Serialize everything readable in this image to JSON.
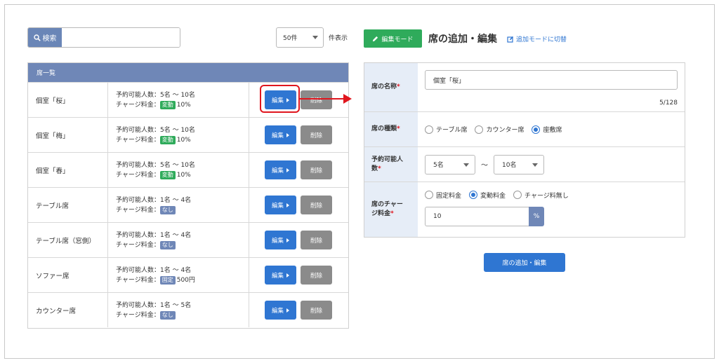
{
  "search": {
    "button_label": "検索",
    "placeholder": ""
  },
  "perpage": {
    "value": "50件",
    "suffix": "件表示"
  },
  "list": {
    "header": "席一覧",
    "edit_label": "編集",
    "delete_label": "削除",
    "rows": [
      {
        "name": "個室「桜」",
        "capacity": "予約可能人数：5名 〜 10名",
        "charge_label": "チャージ料金：",
        "badge": "変動",
        "badge_color": "green",
        "charge_value": "10%"
      },
      {
        "name": "個室「梅」",
        "capacity": "予約可能人数：5名 〜 10名",
        "charge_label": "チャージ料金：",
        "badge": "変動",
        "badge_color": "green",
        "charge_value": "10%"
      },
      {
        "name": "個室「春」",
        "capacity": "予約可能人数：5名 〜 10名",
        "charge_label": "チャージ料金：",
        "badge": "変動",
        "badge_color": "green",
        "charge_value": "10%"
      },
      {
        "name": "テーブル席",
        "capacity": "予約可能人数：1名 〜 4名",
        "charge_label": "チャージ料金：",
        "badge": "なし",
        "badge_color": "blue",
        "charge_value": ""
      },
      {
        "name": "テーブル席（窓側）",
        "capacity": "予約可能人数：1名 〜 4名",
        "charge_label": "チャージ料金：",
        "badge": "なし",
        "badge_color": "blue",
        "charge_value": ""
      },
      {
        "name": "ソファー席",
        "capacity": "予約可能人数：1名 〜 4名",
        "charge_label": "チャージ料金：",
        "badge": "固定",
        "badge_color": "blue",
        "charge_value": "500円"
      },
      {
        "name": "カウンター席",
        "capacity": "予約可能人数：1名 〜 5名",
        "charge_label": "チャージ料金：",
        "badge": "なし",
        "badge_color": "blue",
        "charge_value": ""
      }
    ]
  },
  "form": {
    "mode_button": "編集モード",
    "title": "席の追加・編集",
    "switch_link": "追加モードに切替",
    "name_label": "席の名称",
    "name_value": "個室「桜」",
    "name_counter": "5/128",
    "type_label": "席の種類",
    "type_options": [
      "テーブル席",
      "カウンター席",
      "座敷席"
    ],
    "type_selected": 2,
    "capacity_label_line1": "予約可能人",
    "capacity_label_line2": "数",
    "capacity_min": "5名",
    "capacity_sep": "〜",
    "capacity_max": "10名",
    "fee_label_line1": "席のチャー",
    "fee_label_line2": "ジ料金",
    "fee_options": [
      "固定料金",
      "変動料金",
      "チャージ料無し"
    ],
    "fee_selected": 1,
    "fee_value": "10",
    "fee_unit": "%",
    "required_mark": "*",
    "submit": "席の追加・編集"
  },
  "colors": {
    "accent_blue": "#2f76d2",
    "header_blue": "#6f87b7",
    "green": "#2fab5b",
    "highlight_red": "#e0161e"
  }
}
